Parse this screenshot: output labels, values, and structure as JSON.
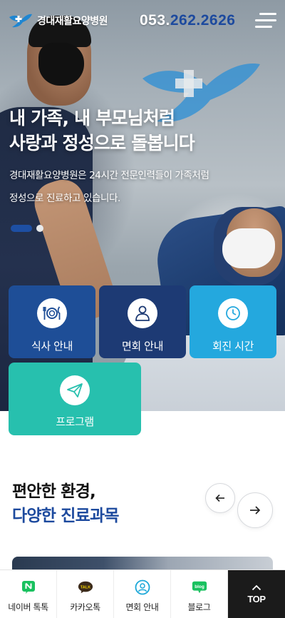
{
  "header": {
    "logo_text": "경대재활요양병원",
    "phone_prefix": "053.",
    "phone_rest": "262.2626"
  },
  "hero": {
    "title_lines": [
      "내 가족, 내 부모님처럼",
      "사랑과 정성으로 돌봅니다"
    ],
    "desc_lines": [
      "경대재활요양병원은 24시간 전문인력들이 가족처럼",
      "정성으로 진료하고 있습니다."
    ],
    "slide_count": 2,
    "active_slide": 1
  },
  "quick_menu": [
    {
      "label": "식사 안내",
      "icon": "meal-icon",
      "color": "#1e4e97"
    },
    {
      "label": "면회 안내",
      "icon": "visitor-icon",
      "color": "#1d3a74"
    },
    {
      "label": "회진 시간",
      "icon": "clock-icon",
      "color": "#24a8de"
    },
    {
      "label": "프로그램",
      "icon": "paper-plane-icon",
      "color": "#27c0ae"
    }
  ],
  "section": {
    "title_line1": "편안한 환경,",
    "title_line2": "다양한 진료과목"
  },
  "bottom_bar": {
    "items": [
      {
        "label": "네이버 톡톡",
        "icon": "naver-talk-icon"
      },
      {
        "label": "카카오톡",
        "icon": "kakaotalk-icon"
      },
      {
        "label": "면회 안내",
        "icon": "visit-guide-icon"
      },
      {
        "label": "블로그",
        "icon": "blog-icon"
      }
    ],
    "top_label": "TOP"
  },
  "colors": {
    "brand_blue": "#1d4a9e",
    "tile_navy": "#1d3a74",
    "tile_sky": "#24a8de",
    "tile_teal": "#27c0ae"
  }
}
